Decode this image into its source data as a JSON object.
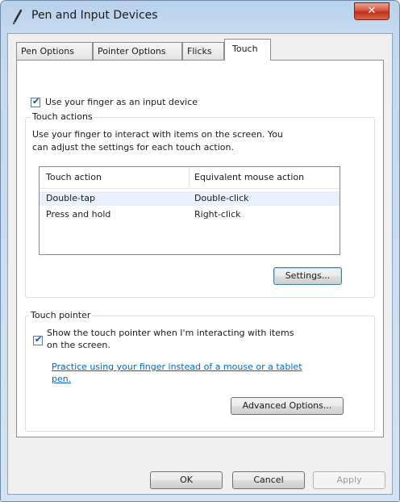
{
  "window": {
    "title": "Pen and Input Devices",
    "close_glyph": "✕"
  },
  "tabs": [
    {
      "label": "Pen Options"
    },
    {
      "label": "Pointer Options"
    },
    {
      "label": "Flicks"
    },
    {
      "label": "Touch",
      "active": true
    }
  ],
  "touch": {
    "use_finger_label": "Use your finger as an input device",
    "use_finger_checked": true,
    "actions_group": {
      "legend": "Touch actions",
      "description_line1": "Use your finger to interact with items on the screen. You",
      "description_line2": "can adjust the settings for each touch action.",
      "columns": [
        "Touch action",
        "Equivalent mouse action"
      ],
      "rows": [
        {
          "action": "Double-tap",
          "mouse": "Double-click",
          "selected": true
        },
        {
          "action": "Press and hold",
          "mouse": "Right-click",
          "selected": false
        }
      ],
      "settings_button": "Settings..."
    },
    "pointer_group": {
      "legend": "Touch pointer",
      "show_pointer_line1": "Show the touch pointer when I'm interacting with items",
      "show_pointer_line2": "on the screen.",
      "show_pointer_checked": true,
      "practice_link_line1": "Practice using your finger instead of a mouse or a tablet",
      "practice_link_line2": "pen.",
      "advanced_button": "Advanced Options..."
    }
  },
  "buttons": {
    "ok": "OK",
    "cancel": "Cancel",
    "apply": "Apply"
  },
  "colors": {
    "accent_link": "#0066cc",
    "selected_row": "#e8f1fb",
    "close_button": "#c1301a"
  }
}
